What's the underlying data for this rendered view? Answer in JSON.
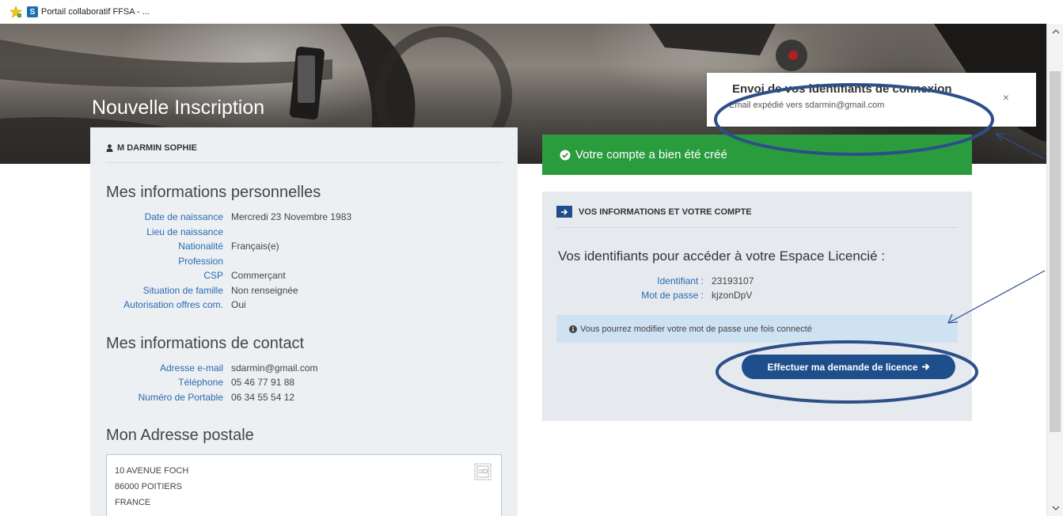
{
  "browser": {
    "tab_title": "Portail collaboratif FFSA - ..."
  },
  "page": {
    "title": "Nouvelle Inscription"
  },
  "user": {
    "name": "M DARMIN SOPHIE"
  },
  "personal": {
    "title": "Mes informations personnelles",
    "rows": [
      {
        "label": "Date de naissance",
        "value": "Mercredi 23 Novembre 1983"
      },
      {
        "label": "Lieu de naissance",
        "value": ""
      },
      {
        "label": "Nationalité",
        "value": "Français(e)"
      },
      {
        "label": "Profession",
        "value": ""
      },
      {
        "label": "CSP",
        "value": "Commerçant"
      },
      {
        "label": "Situation de famille",
        "value": "Non renseignée"
      },
      {
        "label": "Autorisation offres com.",
        "value": "Oui"
      }
    ]
  },
  "contact": {
    "title": "Mes informations de contact",
    "rows": [
      {
        "label": "Adresse e-mail",
        "value": "sdarmin@gmail.com"
      },
      {
        "label": "Téléphone",
        "value": "05 46 77 91 88"
      },
      {
        "label": "Numéro de Portable",
        "value": "06 34 55 54 12"
      }
    ]
  },
  "address": {
    "title": "Mon Adresse postale",
    "lines": [
      "10 AVENUE FOCH",
      "86000 POITIERS",
      "FRANCE"
    ]
  },
  "success": {
    "message": "Votre compte a bien été créé"
  },
  "account": {
    "header": "VOS INFORMATIONS ET VOTRE COMPTE",
    "subtitle": "Vos identifiants pour accéder à votre Espace Licencié :",
    "id_label": "Identifiant :",
    "id_value": "23193107",
    "pwd_label": "Mot de passe :",
    "pwd_value": "kjzonDpV",
    "notice": "Vous pourrez modifier votre mot de passe une fois connecté",
    "button_label": "Effectuer ma demande de licence"
  },
  "toast": {
    "title": "Envoi de vos identifiants de connexion",
    "text": "Email expédié vers sdarmin@gmail.com",
    "close": "×"
  },
  "colors": {
    "primary": "#1f4e8c",
    "success": "#2a9c3e",
    "link": "#2a6ab3",
    "annotation": "#2c4f8a"
  }
}
